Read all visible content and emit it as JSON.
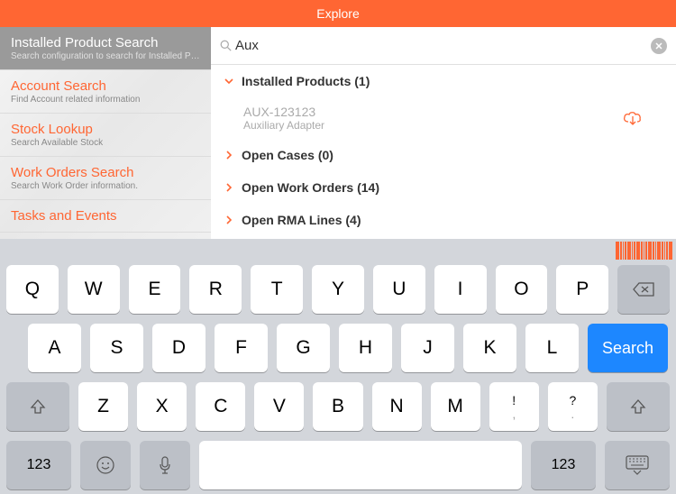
{
  "header": {
    "title": "Explore"
  },
  "sidebar": {
    "items": [
      {
        "title": "Installed Product Search",
        "sub": "Search configuration to search for Installed Pr..."
      },
      {
        "title": "Account Search",
        "sub": "Find Account related information"
      },
      {
        "title": "Stock Lookup",
        "sub": "Search Available Stock"
      },
      {
        "title": "Work Orders Search",
        "sub": "Search Work Order information."
      },
      {
        "title": "Tasks and Events",
        "sub": ""
      }
    ]
  },
  "search": {
    "value": "Aux",
    "placeholder": ""
  },
  "sections": [
    {
      "label": "Installed Products (1)",
      "expanded": true,
      "items": [
        {
          "title": "AUX-123123",
          "sub": "Auxiliary Adapter"
        }
      ]
    },
    {
      "label": "Open Cases (0)",
      "expanded": false
    },
    {
      "label": "Open Work Orders (14)",
      "expanded": false
    },
    {
      "label": "Open RMA Lines (4)",
      "expanded": false
    }
  ],
  "keyboard": {
    "row1": [
      "Q",
      "W",
      "E",
      "R",
      "T",
      "Y",
      "U",
      "I",
      "O",
      "P"
    ],
    "row2": [
      "A",
      "S",
      "D",
      "F",
      "G",
      "H",
      "J",
      "K",
      "L"
    ],
    "row3": [
      "Z",
      "X",
      "C",
      "V",
      "B",
      "N",
      "M"
    ],
    "punct1_top": "!",
    "punct1_bot": ",",
    "punct2_top": "?",
    "punct2_bot": ".",
    "search": "Search",
    "num": "123"
  }
}
